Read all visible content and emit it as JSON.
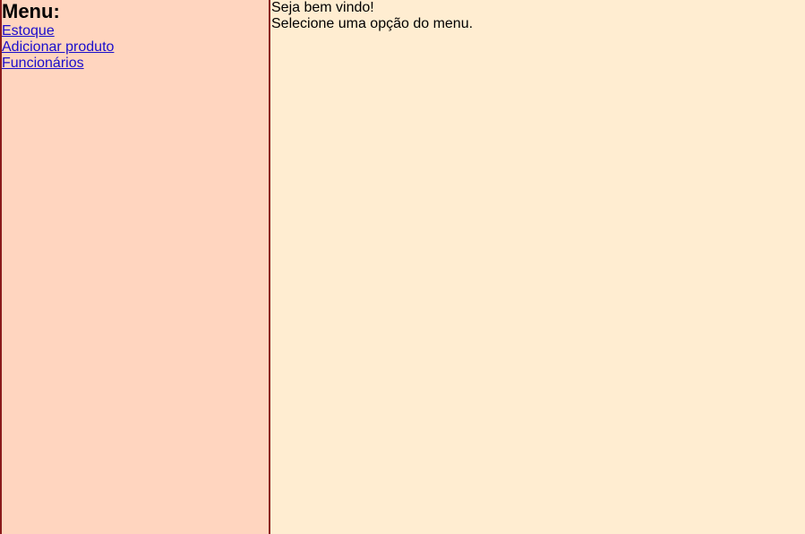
{
  "menu": {
    "title": "Menu:",
    "links": [
      {
        "label": "Estoque"
      },
      {
        "label": "Adicionar produto"
      },
      {
        "label": "Funcionários"
      }
    ]
  },
  "content": {
    "welcome": "Seja bem vindo!",
    "instruction": "Selecione uma opção do menu."
  },
  "colors": {
    "menu_background": "#FFD5BF",
    "content_background": "#FFEDD1",
    "frame_border": "#8B1A1A",
    "link": "#1A0DCC"
  }
}
